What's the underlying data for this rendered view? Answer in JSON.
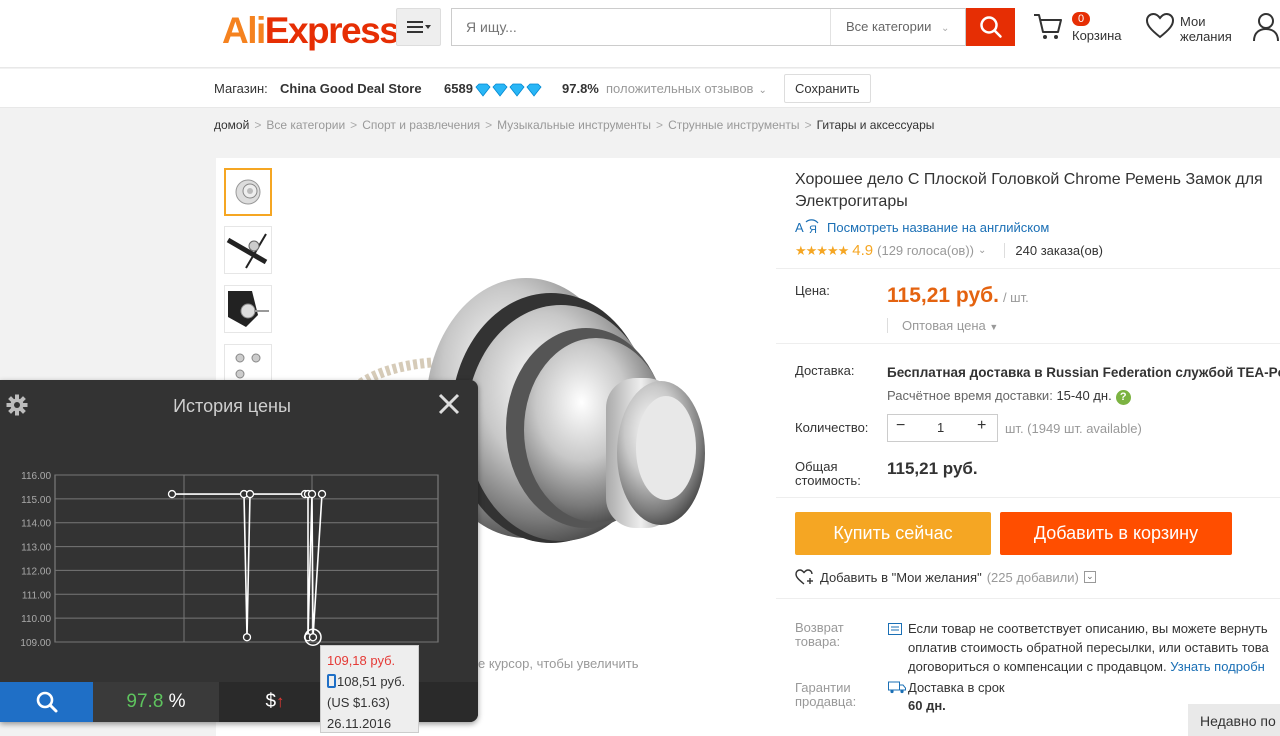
{
  "header": {
    "logo_ali": "Ali",
    "logo_express": "Express",
    "logo_tm": "®",
    "search_placeholder": "Я ищу...",
    "category": "Все категории",
    "cart_count": "0",
    "cart_label": "Корзина",
    "wish_label_1": "Мои",
    "wish_label_2": "желания"
  },
  "store": {
    "label": "Магазин:",
    "name": "China Good Deal Store",
    "rating": "6589",
    "positive_pct": "97.8%",
    "positive_label": "положительных отзывов",
    "save_label": "Сохранить"
  },
  "breadcrumb": [
    "домой",
    "Все категории",
    "Спорт и развлечения",
    "Музыкальные инструменты",
    "Струнные инструменты",
    "Гитары и аксессуары"
  ],
  "product": {
    "title": "Хорошее дело С Плоской Головкой Chrome Ремень Замок для Электрогитары",
    "translate_label": "Посмотреть название на английском",
    "rating": "4.9",
    "votes": "(129 голоса(ов))",
    "orders": "240 заказа(ов)",
    "price_label": "Цена:",
    "price": "115,21 руб.",
    "price_unit": "/ шт.",
    "wholesale": "Оптовая цена",
    "delivery_label": "Доставка:",
    "delivery": "Бесплатная доставка в Russian Federation службой TEA-Post",
    "delivery_time_label": "Расчётное время доставки:",
    "delivery_time": "15-40 дн.",
    "qty_label": "Количество:",
    "qty": "1",
    "qty_unit": "шт. (1949 шт. available)",
    "total_label_1": "Общая",
    "total_label_2": "стоимость:",
    "total": "115,21 руб.",
    "buy_now": "Купить сейчас",
    "add_to_cart": "Добавить в корзину",
    "add_wish": "Добавить в \"Мои желания\"",
    "wish_count": "(225 добавили)",
    "return_label_1": "Возврат",
    "return_label_2": "товара:",
    "return_line_1": "Если товар не соответствует описанию, вы можете вернуть",
    "return_line_2": "оплатив стоимость обратной пересылки, или оставить това",
    "return_line_3": "договориться о компенсации с продавцом.",
    "return_link": "Узнать подробн",
    "guarantee_label_1": "Гарантии",
    "guarantee_label_2": "продавца:",
    "guarantee": "Доставка в срок",
    "guarantee_days": "60 дн.",
    "zoom_hint": "е курсор, чтобы увеличить",
    "recently_viewed": "Недавно по"
  },
  "price_history": {
    "title": "История цены",
    "positive_value": "97.8",
    "positive_symbol": "%",
    "currency_symbol": "$",
    "trend_arrow": "↑",
    "more_symbol": ")",
    "tooltip_price": "109,18 руб.",
    "tooltip_mobile_price": "108,51 руб.",
    "tooltip_usd": "(US $1.63)",
    "tooltip_date": "26.11.2016"
  },
  "chart_data": {
    "type": "line",
    "y_ticks": [
      "116.00",
      "115.00",
      "114.00",
      "113.00",
      "112.00",
      "111.00",
      "110.00",
      "109.00"
    ],
    "ylim": [
      109,
      116
    ],
    "grid": true,
    "series": [
      {
        "values": [
          115.2,
          115.2,
          109.2,
          115.2,
          115.2,
          115.2,
          109.2,
          115.2,
          109.2,
          115.2
        ]
      }
    ]
  },
  "colors": {
    "accent": "#e62e04",
    "orange": "#f5a623",
    "price": "#e46310",
    "link": "#1a6fb5",
    "overlay_bg": "#333333"
  }
}
